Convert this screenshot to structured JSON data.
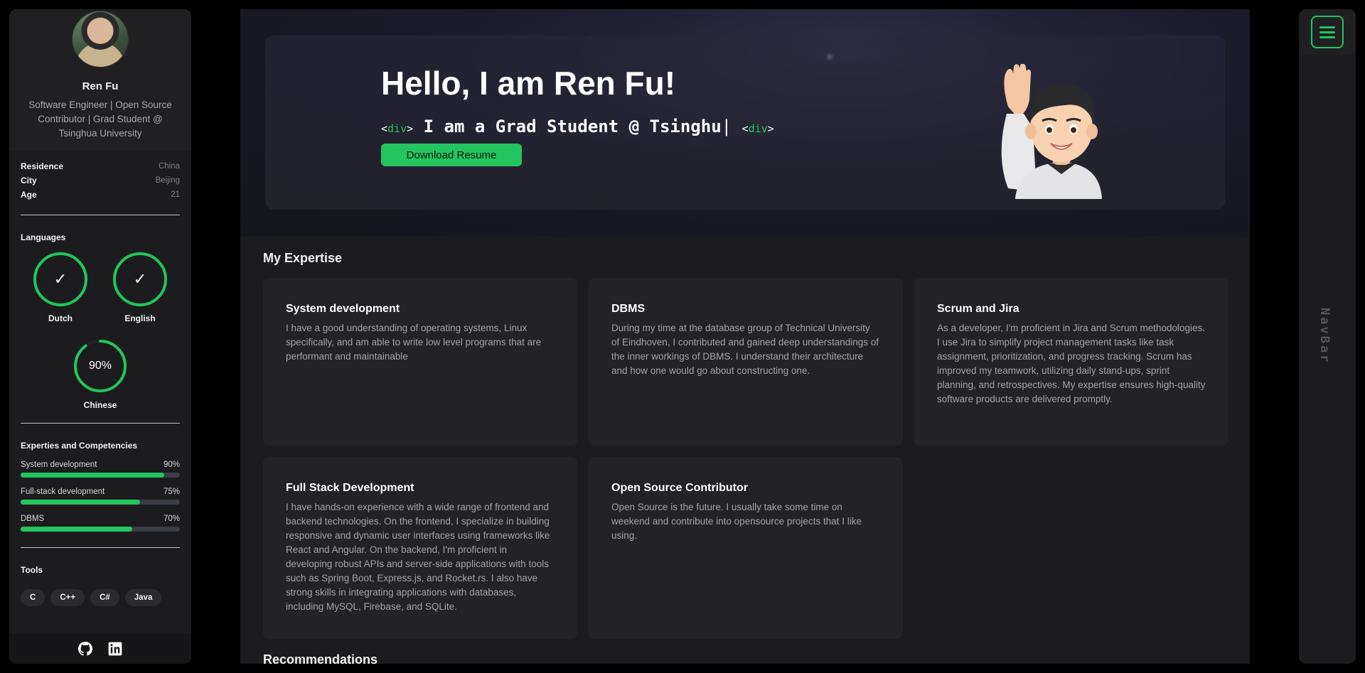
{
  "profile": {
    "name": "Ren Fu",
    "bio": "Software Engineer | Open Source Contributor | Grad Student @ Tsinghua University"
  },
  "info": [
    {
      "label": "Residence",
      "value": "China"
    },
    {
      "label": "City",
      "value": "Beijing"
    },
    {
      "label": "Age",
      "value": "21"
    }
  ],
  "languages": {
    "title": "Languages",
    "items": [
      {
        "name": "Dutch",
        "mark": "✓"
      },
      {
        "name": "English",
        "mark": "✓"
      },
      {
        "name": "Chinese",
        "percent_label": "90%",
        "percent": 90
      }
    ]
  },
  "skills": {
    "title": "Experties and Competencies",
    "items": [
      {
        "name": "System development",
        "label": "90%",
        "percent": 90
      },
      {
        "name": "Full-stack development",
        "label": "75%",
        "percent": 75
      },
      {
        "name": "DBMS",
        "label": "70%",
        "percent": 70
      }
    ]
  },
  "tools": {
    "title": "Tools",
    "items": [
      "C",
      "C++",
      "C#",
      "Java"
    ]
  },
  "footer_icons": [
    "github-icon",
    "linkedin-icon"
  ],
  "hero": {
    "title": "Hello, I am Ren Fu!",
    "tag_open": "div",
    "tag_close": "div",
    "typed_text": "I am a Grad Student @ Tsinghu",
    "cursor": "|",
    "download_label": "Download Resume"
  },
  "expertise": {
    "title": "My Expertise",
    "cards": [
      {
        "title": "System development",
        "text": "I have a good understanding of operating systems, Linux specifically, and am able to write low level programs that are performant and maintainable"
      },
      {
        "title": "DBMS",
        "text": "During my time at the database group of Technical University of Eindhoven, I contributed and gained deep understandings of the inner workings of DBMS. I understand their architecture and how one would go about constructing one."
      },
      {
        "title": "Scrum and Jira",
        "text": "As a developer, I'm proficient in Jira and Scrum methodologies. I use Jira to simplify project management tasks like task assignment, prioritization, and progress tracking. Scrum has improved my teamwork, utilizing daily stand-ups, sprint planning, and retrospectives. My expertise ensures high-quality software products are delivered promptly."
      },
      {
        "title": "Full Stack Development",
        "text": "I have hands-on experience with a wide range of frontend and backend technologies. On the frontend, I specialize in building responsive and dynamic user interfaces using frameworks like React and Angular. On the backend, I'm proficient in developing robust APIs and server-side applications with tools such as Spring Boot, Express.js, and Rocket.rs. I also have strong skills in integrating applications with databases, including MySQL, Firebase, and SQLite."
      },
      {
        "title": "Open Source Contributor",
        "text": "Open Source is the future. I usually take some time on weekend and contribute into opensource projects that I like using."
      }
    ]
  },
  "recommendations_title": "Recommendations",
  "navbar_label": "NavBar",
  "colors": {
    "accent": "#22c55e",
    "panel": "#1c1c1f",
    "card": "#232326"
  }
}
